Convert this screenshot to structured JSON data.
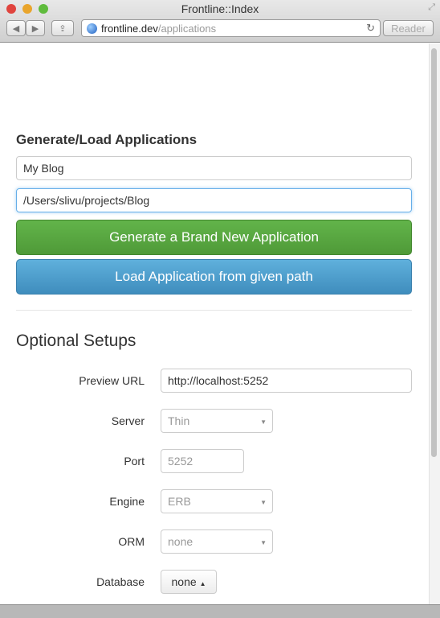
{
  "window": {
    "title": "Frontline::Index",
    "url_host": "frontline.dev",
    "url_path": "/applications",
    "reader": "Reader"
  },
  "generate": {
    "heading": "Generate/Load Applications",
    "name_value": "My Blog",
    "path_value": "/Users/slivu/projects/Blog",
    "generate_label": "Generate a Brand New Application",
    "load_label": "Load Application from given path"
  },
  "optional": {
    "heading": "Optional Setups",
    "preview_label": "Preview URL",
    "preview_value": "http://localhost:5252",
    "server_label": "Server",
    "server_value": "Thin",
    "port_label": "Port",
    "port_placeholder": "5252",
    "engine_label": "Engine",
    "engine_value": "ERB",
    "orm_label": "ORM",
    "orm_value": "none",
    "database_label": "Database",
    "database_value": "none"
  },
  "colors": {
    "green": "#5da842",
    "blue": "#4d9dcb"
  }
}
